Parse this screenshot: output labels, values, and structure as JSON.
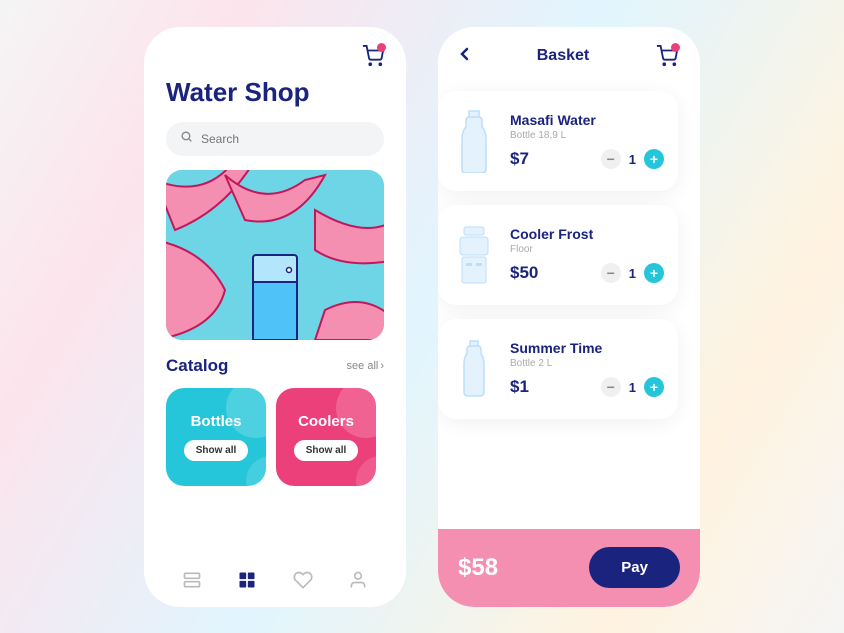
{
  "shop": {
    "title": "Water Shop",
    "search_placeholder": "Search",
    "catalog_label": "Catalog",
    "see_all": "see all",
    "categories": [
      {
        "name": "Bottles",
        "button": "Show all",
        "color": "#26c6da"
      },
      {
        "name": "Coolers",
        "button": "Show all",
        "color": "#ec407a"
      },
      {
        "name": "",
        "button": "",
        "color": "#ff9800"
      }
    ]
  },
  "basket": {
    "title": "Basket",
    "items": [
      {
        "name": "Masafi Water",
        "subtitle": "Bottle 18,9 L",
        "price": "$7",
        "qty": "1"
      },
      {
        "name": "Cooler Frost",
        "subtitle": "Floor",
        "price": "$50",
        "qty": "1"
      },
      {
        "name": "Summer Time",
        "subtitle": "Bottle 2 L",
        "price": "$1",
        "qty": "1"
      }
    ],
    "total": "$58",
    "pay_label": "Pay"
  }
}
